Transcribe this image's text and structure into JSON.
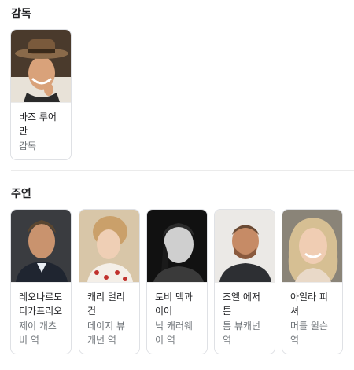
{
  "director_section": {
    "title": "감독",
    "people": [
      {
        "name": "바즈 루어만",
        "role": "감독"
      }
    ]
  },
  "cast_section": {
    "title": "주연",
    "people": [
      {
        "name": "레오나르도 디카프리오",
        "role": "제이 개츠비 역"
      },
      {
        "name": "캐리 멀리건",
        "role": "데이지 뷰캐넌 역"
      },
      {
        "name": "토비 맥과이어",
        "role": "닉 캐러웨이 역"
      },
      {
        "name": "조엘 에저튼",
        "role": "톰 뷰캐넌 역"
      },
      {
        "name": "아일라 피셔",
        "role": "머틀 윌슨 역"
      }
    ]
  }
}
